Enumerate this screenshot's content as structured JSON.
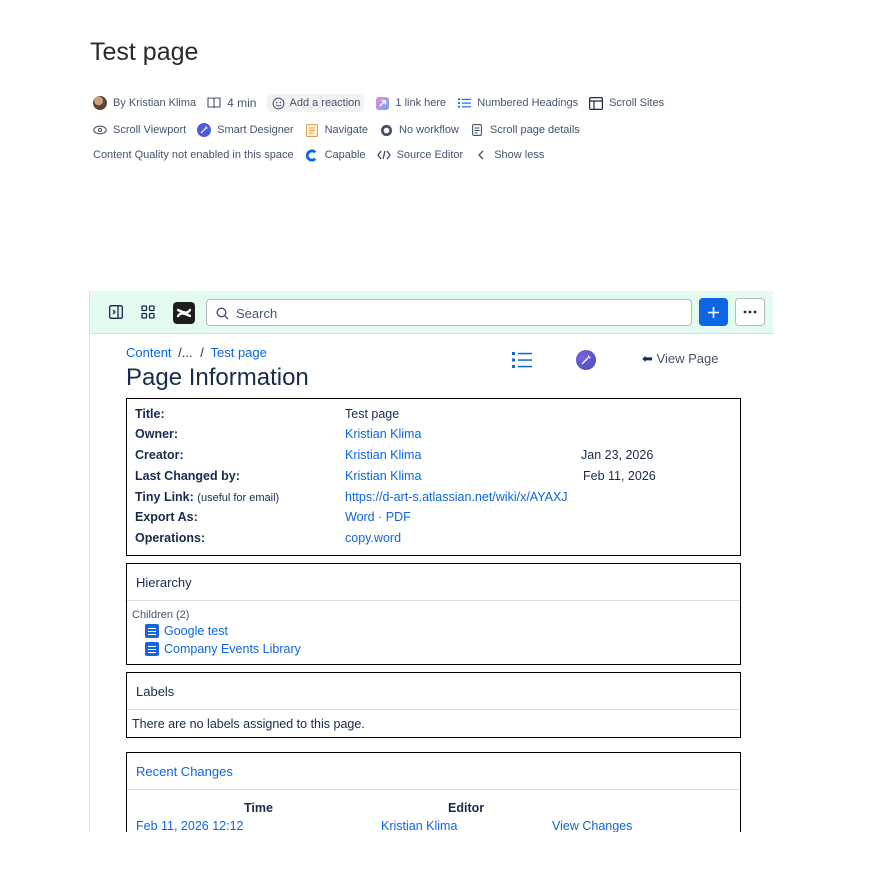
{
  "page": {
    "title": "Test page"
  },
  "meta": {
    "row1": {
      "author": "By Kristian Klima",
      "read_time": "4 min",
      "reaction": "Add a reaction",
      "links": "1 link here",
      "numbered_headings": "Numbered Headings",
      "scroll_sites": "Scroll Sites"
    },
    "row2": {
      "scroll_viewport": "Scroll Viewport",
      "smart_designer": "Smart Designer",
      "navigate": "Navigate",
      "workflow": "No workflow",
      "scroll_page_details": "Scroll page details"
    },
    "row3": {
      "content_quality": "Content Quality not enabled in this space",
      "capable": "Capable",
      "source_editor": "Source Editor",
      "show_less": "Show less"
    }
  },
  "embedded": {
    "search_placeholder": "Search",
    "breadcrumb": {
      "content": "Content",
      "sep1": "/...",
      "sep2": "/",
      "page": "Test page"
    },
    "view_page": "View Page",
    "heading": "Page Information",
    "info": {
      "title_label": "Title:",
      "title_value": "Test page",
      "owner_label": "Owner:",
      "owner_value": "Kristian Klima",
      "creator_label": "Creator:",
      "creator_value": "Kristian Klima",
      "creator_date": "Jan 23, 2026",
      "changed_label": "Last Changed by:",
      "changed_value": "Kristian Klima",
      "changed_date": "Feb 11, 2026",
      "tiny_label": "Tiny Link:",
      "tiny_note": "(useful for email)",
      "tiny_value": "https://d-art-s.atlassian.net/wiki/x/AYAXJ",
      "export_label": "Export As:",
      "export_value": "Word · PDF",
      "ops_label": "Operations:",
      "ops_value": "copy.word"
    },
    "hierarchy": {
      "heading": "Hierarchy",
      "children_label": "Children (2)",
      "children": [
        "Google test",
        "Company Events Library"
      ]
    },
    "labels": {
      "heading": "Labels",
      "empty": "There are no labels assigned to this page."
    },
    "recent": {
      "heading": "Recent Changes",
      "col_time": "Time",
      "col_editor": "Editor",
      "row": {
        "time": "Feb 11, 2026 12:12",
        "editor": "Kristian Klima",
        "action": "View Changes"
      }
    }
  },
  "colors": {
    "accent": "#0c66e4",
    "topbar": "#e3fcef"
  }
}
